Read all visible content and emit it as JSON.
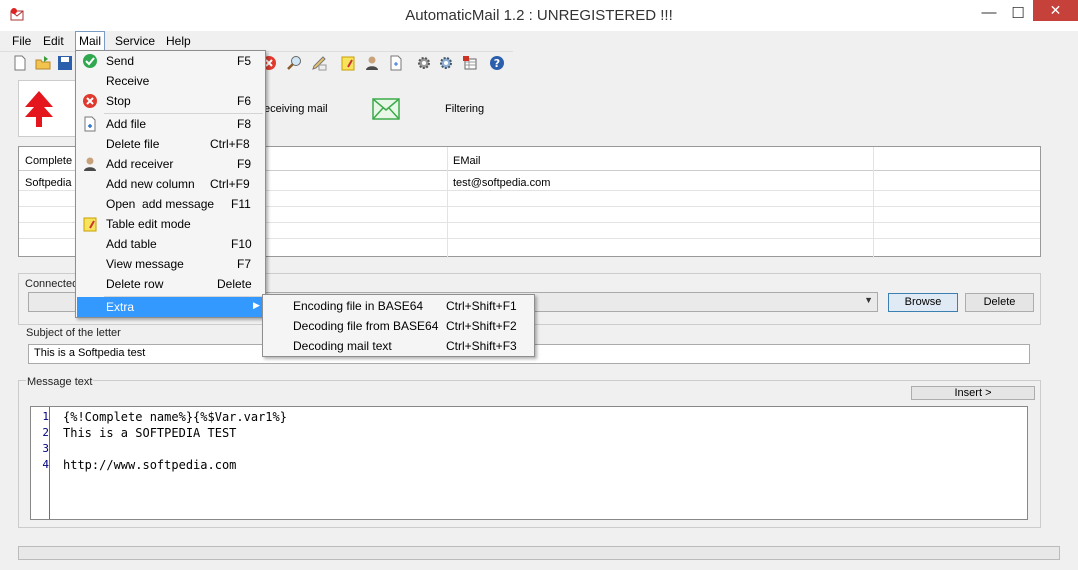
{
  "window": {
    "title": "AutomaticMail 1.2 : UNREGISTERED !!!",
    "minimize_glyph": "—",
    "maximize_glyph": "☐",
    "close_glyph": "✕"
  },
  "menubar": {
    "file": "File",
    "edit": "Edit",
    "mail": "Mail",
    "service": "Service",
    "help": "Help"
  },
  "toolbar": {
    "icons": [
      "new-file-icon",
      "open-icon",
      "save-icon",
      "stop-icon",
      "search-icon",
      "edit-icon",
      "note-icon",
      "receiver-icon",
      "file-icon",
      "settings-icon",
      "settings2-icon",
      "table-icon",
      "help-icon"
    ]
  },
  "tabs": {
    "receiving_mail": "eceiving mail",
    "filtering": "Filtering"
  },
  "grid": {
    "headers": [
      "Complete",
      "",
      "EMail",
      ""
    ],
    "rows": [
      [
        "Softpedia",
        "",
        "test@softpedia.com",
        ""
      ]
    ]
  },
  "connected": {
    "label": "Connected",
    "value": "",
    "browse": "Browse",
    "delete": "Delete"
  },
  "subject": {
    "label": "Subject of the letter",
    "value": "This is a Softpedia test"
  },
  "message": {
    "label": "Message text",
    "insert": "Insert >",
    "lines": [
      {
        "n": "1",
        "text": "{%!Complete name%}{%$Var.var1%}"
      },
      {
        "n": "2",
        "text": "This is a SOFTPEDIA TEST"
      },
      {
        "n": "3",
        "text": ""
      },
      {
        "n": "4",
        "text": "http://www.softpedia.com"
      }
    ]
  },
  "mail_menu": {
    "items": [
      {
        "label": "Send",
        "shortcut": "F5",
        "icon": "check-icon"
      },
      {
        "label": "Receive",
        "shortcut": "",
        "icon": ""
      },
      {
        "label": "Stop",
        "shortcut": "F6",
        "icon": "stop-icon"
      },
      {
        "label": "Add file",
        "shortcut": "F8",
        "icon": "add-file-icon"
      },
      {
        "label": "Delete file",
        "shortcut": "Ctrl+F8",
        "icon": ""
      },
      {
        "label": "Add receiver",
        "shortcut": "F9",
        "icon": "receiver-icon"
      },
      {
        "label": "Add new column",
        "shortcut": "Ctrl+F9",
        "icon": ""
      },
      {
        "label": "Open  add message",
        "shortcut": "F11",
        "icon": ""
      },
      {
        "label": "Table edit mode",
        "shortcut": "",
        "icon": "table-edit-icon"
      },
      {
        "label": "Add table",
        "shortcut": "F10",
        "icon": ""
      },
      {
        "label": "View message",
        "shortcut": "F7",
        "icon": ""
      },
      {
        "label": "Delete row",
        "shortcut": "Delete",
        "icon": ""
      },
      {
        "label": "Extra",
        "shortcut": "",
        "icon": ""
      }
    ]
  },
  "extra_menu": {
    "items": [
      {
        "label": "Encoding file in BASE64",
        "shortcut": "Ctrl+Shift+F1"
      },
      {
        "label": "Decoding file from BASE64",
        "shortcut": "Ctrl+Shift+F2"
      },
      {
        "label": "Decoding mail text",
        "shortcut": "Ctrl+Shift+F3"
      }
    ]
  },
  "colors": {
    "highlight": "#3399ff",
    "close_red": "#c7413b",
    "send_green": "#2fa84f",
    "stop_red": "#e03a2f",
    "arrow_red": "#e4151c"
  }
}
